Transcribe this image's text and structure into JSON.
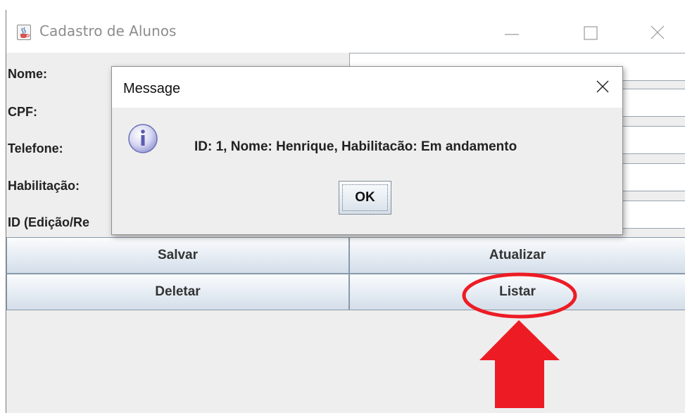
{
  "window": {
    "title": "Cadastro de Alunos",
    "icon": "java-cup-icon"
  },
  "form": {
    "fields": [
      {
        "label": "Nome:"
      },
      {
        "label": "CPF:"
      },
      {
        "label": "Telefone:"
      },
      {
        "label": "Habilitação:"
      },
      {
        "label": "ID (Edição/Re"
      }
    ]
  },
  "buttons": {
    "save": "Salvar",
    "update": "Atualizar",
    "delete": "Deletar",
    "list": "Listar"
  },
  "dialog": {
    "title": "Message",
    "icon": "info-icon",
    "message": "ID: 1, Nome: Henrique, Habilitacão: Em andamento",
    "ok": "OK"
  },
  "annotation": {
    "color": "#ed1c24",
    "shapes": [
      "ellipse-highlight",
      "up-arrow"
    ]
  }
}
